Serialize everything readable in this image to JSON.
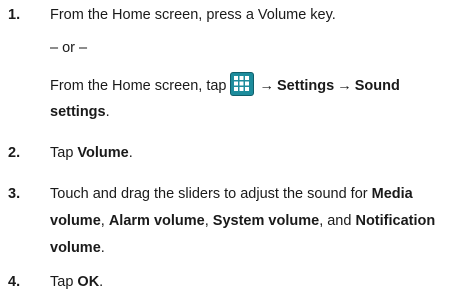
{
  "steps": [
    {
      "number": "1.",
      "line1": "From the Home screen, press a Volume key.",
      "or": "– or –",
      "line3_prefix": "From the Home screen, tap",
      "arrow": "→",
      "settings": "Settings",
      "sound_settings_a": "Sound",
      "sound_settings_b": "settings",
      "period": "."
    },
    {
      "number": "2.",
      "prefix": "Tap ",
      "bold": "Volume",
      "suffix": "."
    },
    {
      "number": "3.",
      "line1_prefix": "Touch and drag the sliders to adjust the sound for ",
      "media": "Media",
      "line2_a": "volume",
      "comma": ", ",
      "alarm": "Alarm volume",
      "system": "System volume",
      "and": ", and ",
      "notification": "Notification",
      "line3_a": "volume",
      "period": "."
    },
    {
      "number": "4.",
      "prefix": "Tap ",
      "bold": "OK",
      "suffix": "."
    }
  ],
  "icons": {
    "apps": "apps-grid-icon"
  },
  "colors": {
    "icon_bg": "#1d8c9c",
    "text": "#1a1a1a"
  }
}
